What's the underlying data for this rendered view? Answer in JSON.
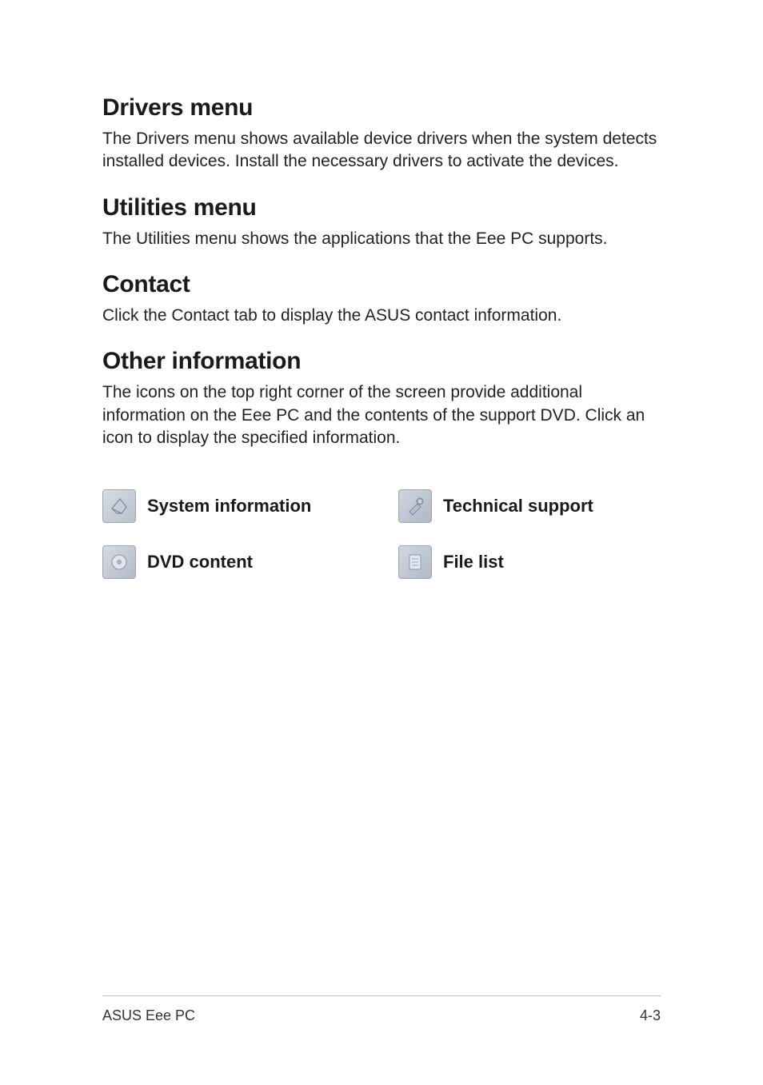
{
  "sections": [
    {
      "heading": "Drivers menu",
      "body": "The Drivers menu shows available device drivers when the system detects installed devices. Install the necessary drivers to activate the devices."
    },
    {
      "heading": "Utilities menu",
      "body": "The Utilities menu shows the applications that the Eee PC supports."
    },
    {
      "heading": "Contact",
      "body": "Click the Contact tab to display the ASUS contact information."
    },
    {
      "heading": "Other information",
      "body": "The icons on the top right corner of the screen provide additional information on the Eee PC and the contents of the support DVD. Click an icon to display the specified information."
    }
  ],
  "icons": {
    "system_information": "System information",
    "technical_support": "Technical support",
    "dvd_content": "DVD content",
    "file_list": "File list"
  },
  "footer": {
    "left": "ASUS Eee PC",
    "right": "4-3"
  }
}
